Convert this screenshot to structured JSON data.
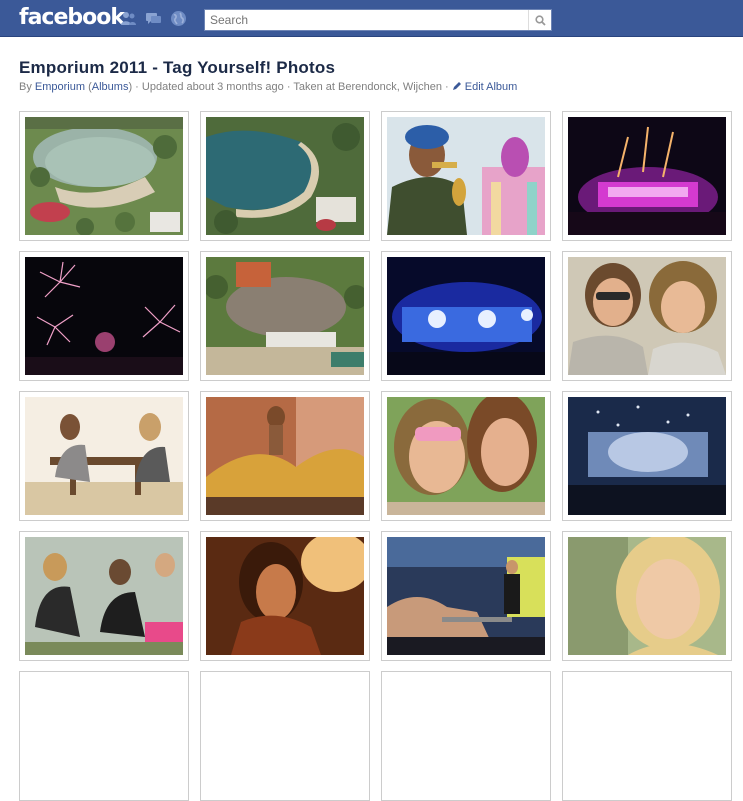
{
  "brand": {
    "logo_text": "facebook",
    "color": "#3b5998"
  },
  "header": {
    "icons": [
      "friend-requests-icon",
      "messages-icon",
      "notifications-globe-icon"
    ],
    "search": {
      "placeholder": "Search",
      "value": "Search"
    }
  },
  "album": {
    "title": "Emporium 2011 - Tag Yourself! Photos",
    "by_prefix": "By",
    "owner": "Emporium",
    "albums_link": "Albums",
    "updated": "Updated about 3 months ago",
    "location": "Taken at Berendonck, Wijchen",
    "edit_label": "Edit Album"
  },
  "photos": [
    "aerial-lake-festival",
    "aerial-lake-beach",
    "trumpet-performer",
    "pink-stage-lights",
    "fireworks-night",
    "aerial-crowd-stage",
    "blue-stage-lights",
    "two-women-sunglasses",
    "women-picnic-table",
    "dancer-yellow-dress",
    "women-pink-sunglasses",
    "stage-confetti",
    "crowd-sitting-grass",
    "woman-orange-light",
    "performer-crowd-barrier",
    "blonde-woman-portrait"
  ]
}
